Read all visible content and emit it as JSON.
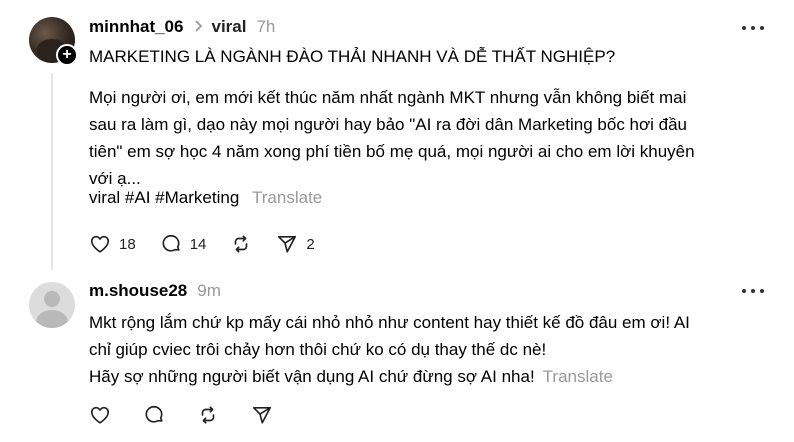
{
  "post": {
    "username": "minnhat_06",
    "topic": "viral",
    "time": "7h",
    "title": "MARKETING LÀ NGÀNH ĐÀO THẢI NHANH VÀ DỄ THẤT NGHIỆP?",
    "body_lines": [
      "Mọi người ơi, em mới kết thúc năm nhất ngành MKT nhưng vẫn không biết mai",
      "sau ra làm gì, dạo này mọi người hay bảo \"AI ra đời dân Marketing bốc hơi đầu",
      "tiên\" em sợ học 4 năm xong phí tiền bố mẹ quá, mọi người ai cho em lời khuyên",
      "với ạ..."
    ],
    "tags": [
      "viral",
      "#AI",
      "#Marketing"
    ],
    "translate_label": "Translate",
    "follow_symbol": "+",
    "likes": "18",
    "comments": "14",
    "shares": "2"
  },
  "reply": {
    "username": "m.shouse28",
    "time": "9m",
    "lines": [
      "Mkt rộng lắm chứ kp mấy cái nhỏ nhỏ như content hay thiết kế đồ đâu em ơi! AI",
      "chỉ giúp cviec trôi chảy hơn thôi chứ ko có dụ thay thế dc nè!",
      "Hãy sợ những người biết vận dụng AI chứ đừng sợ AI nha!"
    ],
    "translate_label": "Translate"
  },
  "icons": {
    "like": "heart-icon",
    "comment": "comment-bubble-icon",
    "repost": "repost-icon",
    "share": "send-icon",
    "more": "more-dots-icon"
  }
}
